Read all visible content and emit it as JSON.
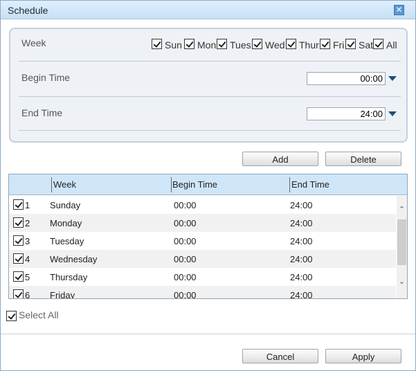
{
  "dialog": {
    "title": "Schedule",
    "close_glyph": "✕"
  },
  "filter": {
    "week_label": "Week",
    "days": [
      {
        "label": "Sun",
        "checked": true
      },
      {
        "label": "Mon",
        "checked": true
      },
      {
        "label": "Tues",
        "checked": true
      },
      {
        "label": "Wed",
        "checked": true
      },
      {
        "label": "Thur",
        "checked": true
      },
      {
        "label": "Fri",
        "checked": true
      },
      {
        "label": "Sat",
        "checked": true
      },
      {
        "label": "All",
        "checked": true
      }
    ],
    "begin_label": "Begin Time",
    "begin_value": "00:00",
    "end_label": "End Time",
    "end_value": "24:00"
  },
  "actions": {
    "add_label": "Add",
    "delete_label": "Delete"
  },
  "table": {
    "headers": {
      "week": "Week",
      "begin": "Begin Time",
      "end": "End Time"
    },
    "rows": [
      {
        "index": "1",
        "week": "Sunday",
        "begin": "00:00",
        "end": "24:00",
        "checked": true
      },
      {
        "index": "2",
        "week": "Monday",
        "begin": "00:00",
        "end": "24:00",
        "checked": true
      },
      {
        "index": "3",
        "week": "Tuesday",
        "begin": "00:00",
        "end": "24:00",
        "checked": true
      },
      {
        "index": "4",
        "week": "Wednesday",
        "begin": "00:00",
        "end": "24:00",
        "checked": true
      },
      {
        "index": "5",
        "week": "Thursday",
        "begin": "00:00",
        "end": "24:00",
        "checked": true
      },
      {
        "index": "6",
        "week": "Friday",
        "begin": "00:00",
        "end": "24:00",
        "checked": true
      }
    ]
  },
  "select_all": {
    "label": "Select All",
    "checked": true
  },
  "footer": {
    "cancel_label": "Cancel",
    "apply_label": "Apply"
  },
  "colors": {
    "title_bar": "#c7e0f5",
    "close_button": "#5c97d2",
    "table_header": "#cfe6f9",
    "dropdown_arrow": "#1c4f7a"
  },
  "icons": {
    "close": "close-icon",
    "dropdown": "chevron-down-icon",
    "scroll_up": "chevron-up-icon",
    "scroll_down": "chevron-down-icon"
  }
}
